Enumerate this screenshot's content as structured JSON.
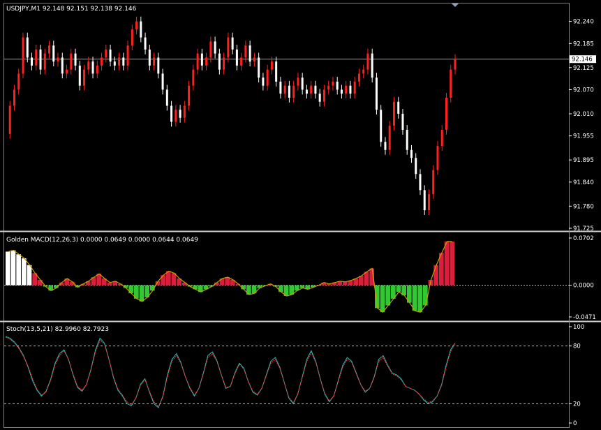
{
  "window": {
    "price_header": "USDJPY,M1  92.148 92.151 92.138 92.146",
    "macd_header": "Golden MACD(12,26,3) 0.0000 0.0649 0.0000 0.0644 0.0649",
    "stoch_header": "Stoch(13,5,21) 82.9960 82.7923",
    "current_price_label": "92.146"
  },
  "colors": {
    "background": "#000000",
    "bull_candle": "#ff2020",
    "bear_candle": "#ffffff",
    "macd_up": "#dc1e3c",
    "macd_down": "#32c832",
    "macd_white": "#ffffff",
    "macd_line": "#c8a000",
    "stoch_main": "#20c0c0",
    "stoch_signal": "#ff3030",
    "grid_dash": "#c0c0c0"
  },
  "chart_data": [
    {
      "type": "line",
      "name": "USDJPY,M1",
      "y_ticks": [
        "92.240",
        "92.185",
        "92.125",
        "92.070",
        "92.010",
        "91.955",
        "91.895",
        "91.840",
        "91.780",
        "91.725"
      ],
      "ylim": [
        91.725,
        92.255
      ],
      "current_price": 92.146,
      "series": [
        {
          "name": "close",
          "values": [
            91.96,
            92.03,
            92.07,
            92.11,
            92.2,
            92.15,
            92.13,
            92.17,
            92.12,
            92.16,
            92.18,
            92.14,
            92.15,
            92.11,
            92.12,
            92.16,
            92.13,
            92.08,
            92.12,
            92.14,
            92.11,
            92.13,
            92.15,
            92.17,
            92.14,
            92.13,
            92.15,
            92.13,
            92.18,
            92.22,
            92.24,
            92.2,
            92.17,
            92.13,
            92.15,
            92.11,
            92.07,
            92.03,
            91.99,
            92.02,
            92.0,
            92.03,
            92.08,
            92.12,
            92.16,
            92.13,
            92.15,
            92.19,
            92.16,
            92.12,
            92.15,
            92.2,
            92.17,
            92.13,
            92.15,
            92.18,
            92.14,
            92.15,
            92.1,
            92.08,
            92.12,
            92.14,
            92.09,
            92.06,
            92.08,
            92.05,
            92.08,
            92.1,
            92.07,
            92.06,
            92.08,
            92.06,
            92.04,
            92.07,
            92.08,
            92.09,
            92.07,
            92.06,
            92.08,
            92.06,
            92.09,
            92.11,
            92.12,
            92.16,
            92.1,
            92.02,
            91.94,
            91.92,
            91.98,
            92.04,
            92.01,
            91.97,
            91.92,
            91.9,
            91.86,
            91.82,
            91.77,
            91.81,
            91.87,
            91.93,
            91.97,
            92.05,
            92.12,
            92.146
          ]
        }
      ]
    },
    {
      "type": "bar",
      "name": "Golden MACD(12,26,3)",
      "y_ticks": [
        "0.0702",
        "0.0000",
        "-0.0471"
      ],
      "ylim": [
        -0.0471,
        0.0702
      ],
      "series": [
        {
          "name": "histogram",
          "values": [
            0.05,
            0.052,
            0.046,
            0.04,
            0.03,
            0.018,
            0.008,
            -0.002,
            -0.008,
            -0.004,
            0.004,
            0.01,
            0.005,
            -0.003,
            0.002,
            0.006,
            0.012,
            0.017,
            0.01,
            0.004,
            0.006,
            0.002,
            -0.004,
            -0.012,
            -0.02,
            -0.024,
            -0.018,
            -0.008,
            0.006,
            0.015,
            0.021,
            0.018,
            0.01,
            0.004,
            -0.002,
            -0.006,
            -0.01,
            -0.006,
            -0.002,
            0.004,
            0.01,
            0.012,
            0.008,
            0.002,
            -0.006,
            -0.014,
            -0.012,
            -0.004,
            -0.001,
            0.002,
            -0.002,
            -0.01,
            -0.016,
            -0.014,
            -0.008,
            -0.004,
            -0.006,
            -0.003,
            0.0,
            0.004,
            0.002,
            0.004,
            0.006,
            0.005,
            0.007,
            0.01,
            0.014,
            0.02,
            0.025,
            -0.034,
            -0.04,
            -0.03,
            -0.02,
            -0.01,
            -0.015,
            -0.026,
            -0.038,
            -0.04,
            -0.03,
            0.008,
            0.03,
            0.048,
            0.065,
            0.0649
          ]
        }
      ]
    },
    {
      "type": "line",
      "name": "Stoch(13,5,21)",
      "y_ticks": [
        "100",
        "80",
        "20",
        "0"
      ],
      "ylim": [
        0,
        100
      ],
      "levels": [
        80,
        20
      ],
      "series": [
        {
          "name": "main",
          "values": [
            90,
            88,
            84,
            78,
            70,
            58,
            44,
            34,
            28,
            33,
            45,
            62,
            72,
            76,
            66,
            50,
            37,
            33,
            40,
            56,
            76,
            88,
            83,
            66,
            47,
            34,
            28,
            20,
            18,
            26,
            40,
            46,
            32,
            20,
            16,
            28,
            50,
            66,
            72,
            63,
            48,
            36,
            28,
            36,
            52,
            70,
            74,
            65,
            50,
            36,
            38,
            52,
            62,
            57,
            43,
            32,
            29,
            36,
            50,
            64,
            68,
            58,
            42,
            26,
            20,
            30,
            48,
            66,
            75,
            64,
            46,
            30,
            22,
            28,
            44,
            60,
            68,
            64,
            52,
            40,
            32,
            36,
            48,
            66,
            70,
            60,
            52,
            50,
            46,
            38,
            36,
            34,
            30,
            24,
            20,
            22,
            28,
            40,
            60,
            76,
            82.996
          ]
        },
        {
          "name": "signal",
          "values": [
            89,
            87,
            83,
            77,
            69,
            59,
            46,
            35,
            29,
            32,
            44,
            60,
            70,
            75,
            66,
            51,
            38,
            34,
            40,
            55,
            74,
            86,
            82,
            66,
            48,
            35,
            29,
            22,
            19,
            26,
            39,
            45,
            33,
            22,
            17,
            27,
            48,
            64,
            70,
            62,
            48,
            37,
            29,
            36,
            51,
            68,
            72,
            64,
            50,
            37,
            38,
            51,
            61,
            56,
            43,
            33,
            30,
            36,
            49,
            62,
            66,
            57,
            42,
            27,
            21,
            30,
            47,
            64,
            73,
            63,
            46,
            31,
            23,
            28,
            43,
            58,
            66,
            63,
            51,
            40,
            33,
            36,
            47,
            64,
            68,
            59,
            51,
            49,
            45,
            38,
            36,
            34,
            30,
            25,
            21,
            23,
            28,
            39,
            58,
            74,
            82.7923
          ]
        }
      ]
    }
  ]
}
